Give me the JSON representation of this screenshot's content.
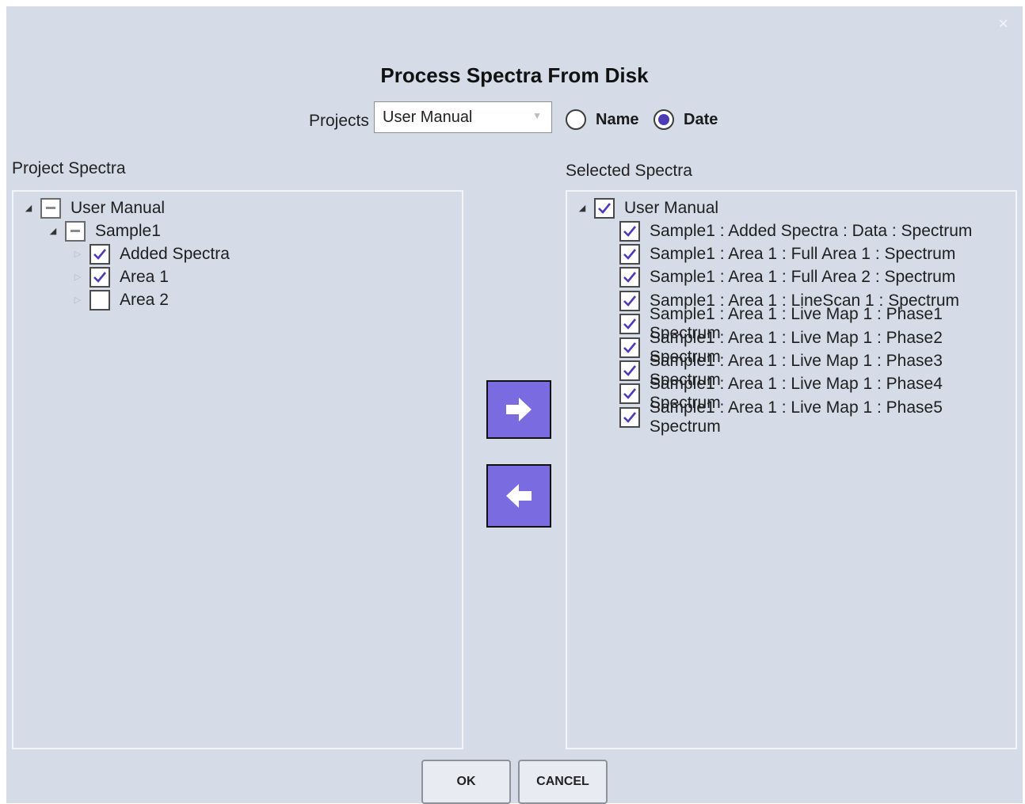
{
  "dialog": {
    "title": "Process Spectra From Disk",
    "close_icon": "×"
  },
  "projects": {
    "label": "Projects",
    "selected": "User Manual",
    "caret_icon": "chevron-down-icon"
  },
  "sort": {
    "options": [
      {
        "label": "Name",
        "selected": false
      },
      {
        "label": "Date",
        "selected": true
      }
    ]
  },
  "project_spectra": {
    "label": "Project Spectra",
    "tree": [
      {
        "label": "User Manual",
        "level": 0,
        "state": "partial",
        "expander": "expanded"
      },
      {
        "label": "Sample1",
        "level": 1,
        "state": "partial",
        "expander": "expanded"
      },
      {
        "label": "Added Spectra",
        "level": 2,
        "state": "checked",
        "expander": "collapsed"
      },
      {
        "label": "Area 1",
        "level": 2,
        "state": "checked",
        "expander": "collapsed"
      },
      {
        "label": "Area 2",
        "level": 2,
        "state": "unchecked",
        "expander": "collapsed"
      }
    ]
  },
  "selected_spectra": {
    "label": "Selected Spectra",
    "root": {
      "label": "User Manual",
      "state": "checked"
    },
    "items": [
      "Sample1 : Added Spectra : Data : Spectrum",
      "Sample1 : Area 1 : Full Area 1 : Spectrum",
      "Sample1 : Area 1 : Full Area 2 : Spectrum",
      "Sample1 : Area 1 : LineScan 1 : Spectrum",
      "Sample1 : Area 1 : Live Map 1 : Phase1 Spectrum",
      "Sample1 : Area 1 : Live Map 1 : Phase2 Spectrum",
      "Sample1 : Area 1 : Live Map 1 : Phase3 Spectrum",
      "Sample1 : Area 1 : Live Map 1 : Phase4 Spectrum",
      "Sample1 : Area 1 : Live Map 1 : Phase5 Spectrum"
    ]
  },
  "buttons": {
    "add_icon": "arrow-right-icon",
    "remove_icon": "arrow-left-icon",
    "ok": "OK",
    "cancel": "CANCEL"
  },
  "colors": {
    "accent": "#7a6be0",
    "check": "#4b3bb6",
    "dialog_bg": "#d5dbe7"
  }
}
